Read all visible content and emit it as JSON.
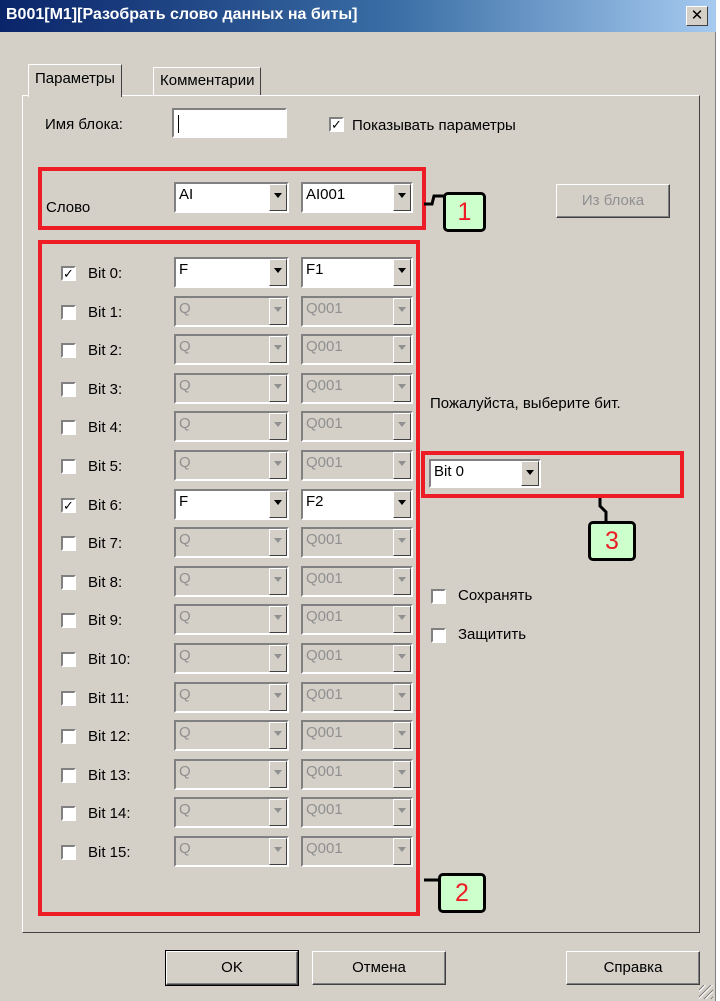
{
  "window": {
    "title": "B001[M1][Разобрать слово данных на биты]",
    "close_glyph": "✕"
  },
  "tabs": [
    {
      "label": "Параметры"
    },
    {
      "label": "Комментарии"
    }
  ],
  "block_name": {
    "label": "Имя блока:",
    "value": ""
  },
  "show_params": {
    "label": "Показывать параметры",
    "checked": true
  },
  "word": {
    "label": "Слово",
    "type": "AI",
    "address": "AI001"
  },
  "from_block_button": "Из блока",
  "bits": [
    {
      "label": "Bit 0:",
      "checked": true,
      "type": "F",
      "address": "F1"
    },
    {
      "label": "Bit 1:",
      "checked": false,
      "type": "Q",
      "address": "Q001"
    },
    {
      "label": "Bit 2:",
      "checked": false,
      "type": "Q",
      "address": "Q001"
    },
    {
      "label": "Bit 3:",
      "checked": false,
      "type": "Q",
      "address": "Q001"
    },
    {
      "label": "Bit 4:",
      "checked": false,
      "type": "Q",
      "address": "Q001"
    },
    {
      "label": "Bit 5:",
      "checked": false,
      "type": "Q",
      "address": "Q001"
    },
    {
      "label": "Bit 6:",
      "checked": true,
      "type": "F",
      "address": "F2"
    },
    {
      "label": "Bit 7:",
      "checked": false,
      "type": "Q",
      "address": "Q001"
    },
    {
      "label": "Bit 8:",
      "checked": false,
      "type": "Q",
      "address": "Q001"
    },
    {
      "label": "Bit 9:",
      "checked": false,
      "type": "Q",
      "address": "Q001"
    },
    {
      "label": "Bit 10:",
      "checked": false,
      "type": "Q",
      "address": "Q001"
    },
    {
      "label": "Bit 11:",
      "checked": false,
      "type": "Q",
      "address": "Q001"
    },
    {
      "label": "Bit 12:",
      "checked": false,
      "type": "Q",
      "address": "Q001"
    },
    {
      "label": "Bit 13:",
      "checked": false,
      "type": "Q",
      "address": "Q001"
    },
    {
      "label": "Bit 14:",
      "checked": false,
      "type": "Q",
      "address": "Q001"
    },
    {
      "label": "Bit 15:",
      "checked": false,
      "type": "Q",
      "address": "Q001"
    }
  ],
  "select_bit": {
    "prompt": "Пожалуйста, выберите бит.",
    "value": "Bit 0"
  },
  "retain": {
    "label": "Сохранять",
    "checked": false
  },
  "protect": {
    "label": "Защитить",
    "checked": false
  },
  "buttons": {
    "ok": "OK",
    "cancel": "Отмена",
    "help": "Справка"
  },
  "callouts": [
    "1",
    "2",
    "3"
  ],
  "colors": {
    "highlight": "#ee1c24",
    "callout_bg": "#ccffcc",
    "title_bar": "#0a246a",
    "dialog_bg": "#d4d0c8"
  }
}
